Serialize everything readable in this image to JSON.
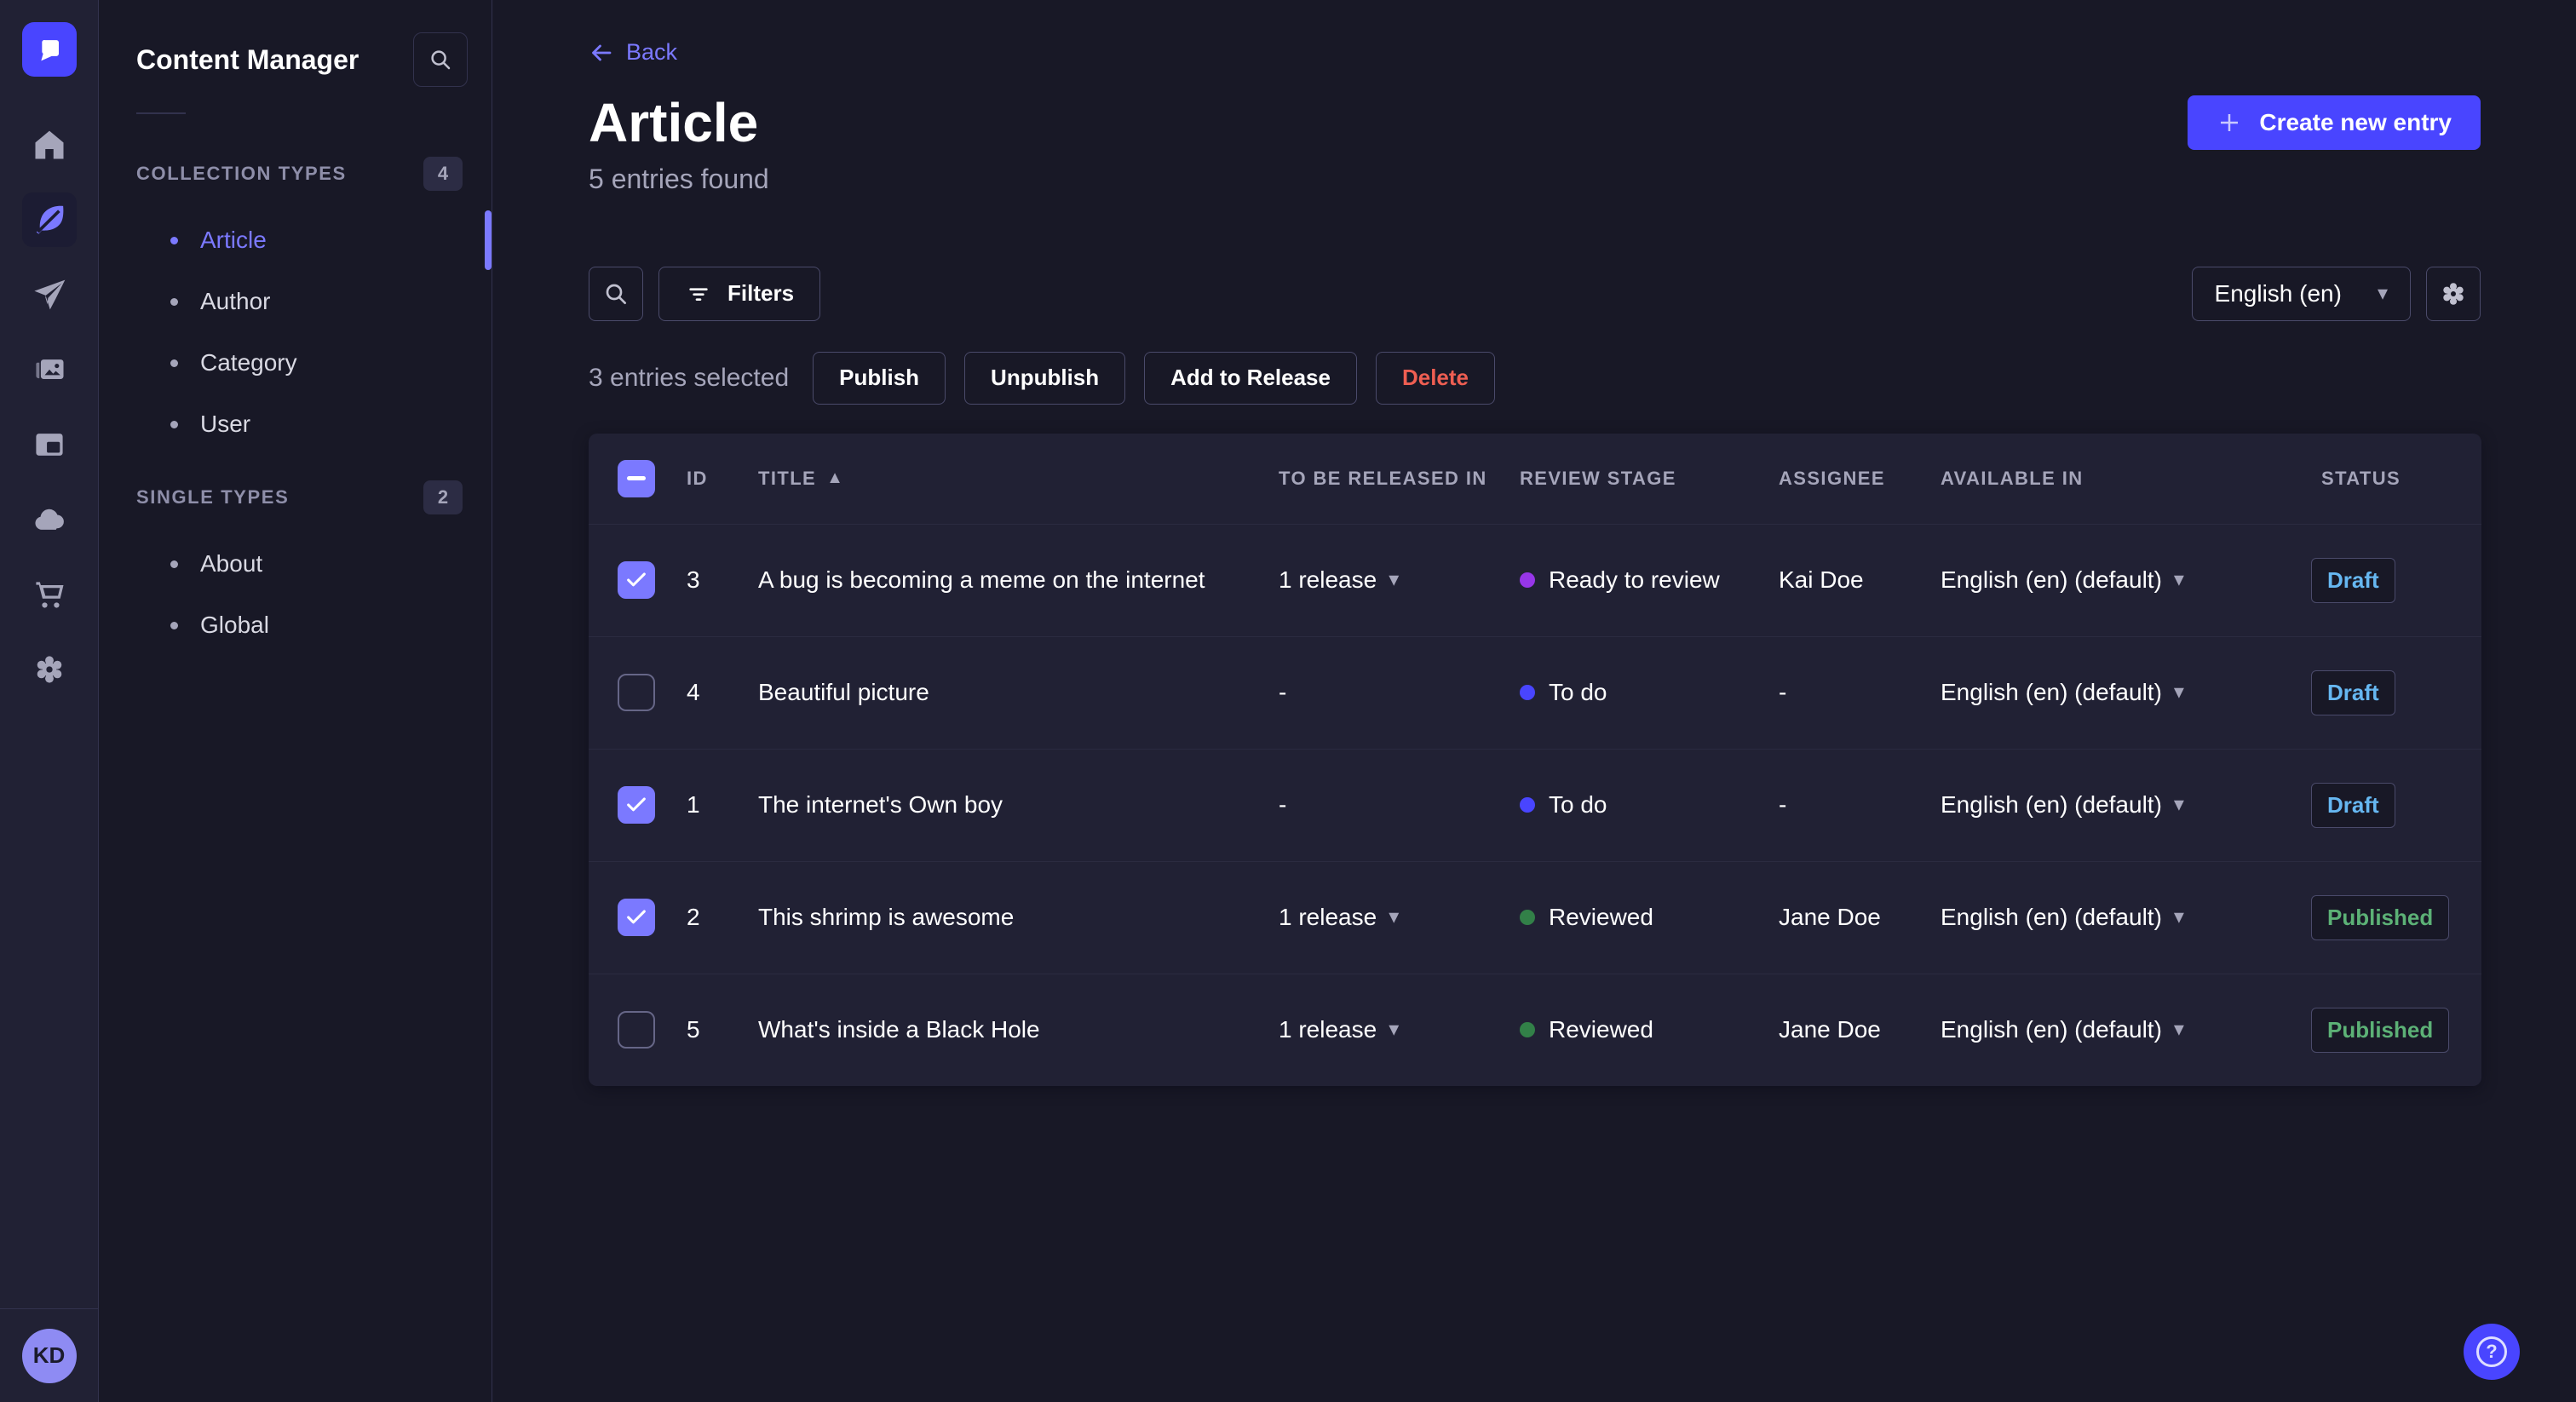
{
  "colors": {
    "accent": "#4945ff",
    "accent_light": "#7b79ff",
    "page_bg": "#181826",
    "surface_bg": "#212134",
    "border": "#32324d",
    "border_light": "#4a4a6a",
    "text_secondary": "#a5a5ba",
    "danger": "#ee5e52",
    "success": "#5cb176",
    "draft_blue": "#66b7f1"
  },
  "nav_rail": {
    "logo_icon": "strapi-logo",
    "items": [
      {
        "icon": "home-icon",
        "active": false
      },
      {
        "icon": "feather-content-manager-icon",
        "active": true
      },
      {
        "icon": "paper-plane-icon",
        "active": false
      },
      {
        "icon": "media-library-icon",
        "active": false
      },
      {
        "icon": "layout-builder-icon",
        "active": false
      },
      {
        "icon": "cloud-icon",
        "active": false
      },
      {
        "icon": "cart-icon",
        "active": false
      },
      {
        "icon": "gear-icon",
        "active": false
      }
    ],
    "avatar_initials": "KD"
  },
  "subnav": {
    "title": "Content Manager",
    "search_icon": "search-icon",
    "sections": [
      {
        "label": "COLLECTION TYPES",
        "badge": "4",
        "items": [
          {
            "label": "Article",
            "active": true
          },
          {
            "label": "Author",
            "active": false
          },
          {
            "label": "Category",
            "active": false
          },
          {
            "label": "User",
            "active": false
          }
        ]
      },
      {
        "label": "SINGLE TYPES",
        "badge": "2",
        "items": [
          {
            "label": "About",
            "active": false
          },
          {
            "label": "Global",
            "active": false
          }
        ]
      }
    ]
  },
  "header": {
    "back_label": "Back",
    "title": "Article",
    "subtitle": "5 entries found",
    "create_button_label": "Create new entry"
  },
  "toolbar": {
    "filters_label": "Filters",
    "locale_selected": "English (en)"
  },
  "selection": {
    "count_text": "3 entries selected",
    "publish_label": "Publish",
    "unpublish_label": "Unpublish",
    "add_to_release_label": "Add to Release",
    "delete_label": "Delete"
  },
  "table": {
    "select_all_state": "indeterminate",
    "columns": {
      "id": "ID",
      "title": "TITLE",
      "released_in": "TO BE RELEASED IN",
      "review_stage": "REVIEW STAGE",
      "assignee": "ASSIGNEE",
      "available_in": "AVAILABLE IN",
      "status": "STATUS"
    },
    "sort": {
      "column": "TITLE",
      "direction": "ascending"
    },
    "rows": [
      {
        "selected": true,
        "id": "3",
        "title": "A bug is becoming a meme on the internet",
        "released_in": "1 release",
        "review_stage": "Ready to review",
        "stage_color": "#9736e8",
        "assignee": "Kai Doe",
        "available_in": "English (en) (default)",
        "status": "Draft",
        "status_color": "#66b7f1"
      },
      {
        "selected": false,
        "id": "4",
        "title": "Beautiful picture",
        "released_in": "-",
        "review_stage": "To do",
        "stage_color": "#4945ff",
        "assignee": "-",
        "available_in": "English (en) (default)",
        "status": "Draft",
        "status_color": "#66b7f1"
      },
      {
        "selected": true,
        "id": "1",
        "title": "The internet's Own boy",
        "released_in": "-",
        "review_stage": "To do",
        "stage_color": "#4945ff",
        "assignee": "-",
        "available_in": "English (en) (default)",
        "status": "Draft",
        "status_color": "#66b7f1"
      },
      {
        "selected": true,
        "id": "2",
        "title": "This shrimp is awesome",
        "released_in": "1 release",
        "review_stage": "Reviewed",
        "stage_color": "#328048",
        "assignee": "Jane Doe",
        "available_in": "English (en) (default)",
        "status": "Published",
        "status_color": "#5cb176"
      },
      {
        "selected": false,
        "id": "5",
        "title": "What's inside a Black Hole",
        "released_in": "1 release",
        "review_stage": "Reviewed",
        "stage_color": "#328048",
        "assignee": "Jane Doe",
        "available_in": "English (en) (default)",
        "status": "Published",
        "status_color": "#5cb176"
      }
    ]
  }
}
